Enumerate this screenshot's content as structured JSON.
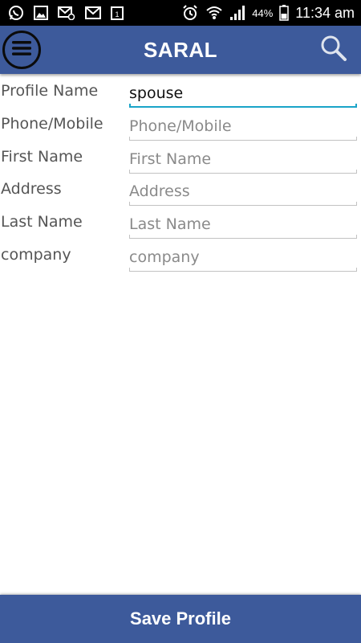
{
  "status_bar": {
    "icons_left": [
      "whatsapp-icon",
      "gallery-icon",
      "email-icon",
      "mail-icon",
      "calendar-icon"
    ],
    "calendar_day": "1",
    "icons_right": [
      "alarm-icon",
      "wifi-icon",
      "signal-icon",
      "battery-icon"
    ],
    "battery_percent": "44%",
    "time": "11:34 am"
  },
  "app_bar": {
    "title": "SARAL",
    "menu_icon": "menu-icon",
    "search_icon": "search-icon",
    "color": "#3d5a9b"
  },
  "form": {
    "fields": [
      {
        "label": "Profile Name",
        "value": "spouse",
        "placeholder": ""
      },
      {
        "label": "Phone/Mobile",
        "value": "",
        "placeholder": "Phone/Mobile"
      },
      {
        "label": "First Name",
        "value": "",
        "placeholder": "First Name"
      },
      {
        "label": "Address",
        "value": "",
        "placeholder": "Address"
      },
      {
        "label": "Last Name",
        "value": "",
        "placeholder": "Last Name"
      },
      {
        "label": "company",
        "value": "",
        "placeholder": "company"
      }
    ]
  },
  "footer": {
    "save_label": "Save Profile"
  },
  "colors": {
    "primary": "#3d5a9b",
    "focus_underline": "#1aa4c8"
  }
}
